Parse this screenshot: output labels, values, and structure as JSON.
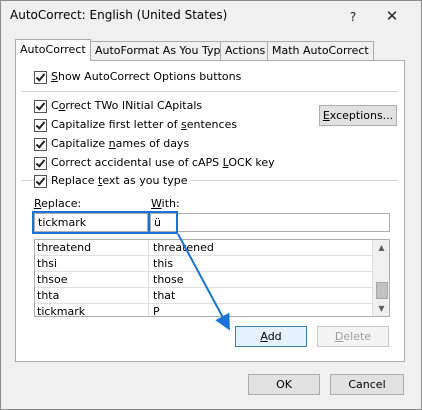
{
  "window": {
    "title": "AutoCorrect: English (United States)",
    "help_glyph": "?",
    "close_glyph": "✕"
  },
  "tabs": [
    {
      "label": "AutoCorrect",
      "active": true
    },
    {
      "label": "AutoFormat As You Type",
      "active": false
    },
    {
      "label": "Actions",
      "active": false
    },
    {
      "label": "Math AutoCorrect",
      "active": false
    }
  ],
  "options": {
    "show_buttons": {
      "pre": "",
      "u": "S",
      "post": "how AutoCorrect Options buttons",
      "checked": true
    },
    "two_initial": {
      "pre": "C",
      "u": "o",
      "post": "rrect TWo INitial CApitals",
      "checked": true
    },
    "first_letter": {
      "pre": "Capitalize first letter of ",
      "u": "s",
      "post": "entences",
      "checked": true
    },
    "days": {
      "pre": "Capitalize ",
      "u": "n",
      "post": "ames of days",
      "checked": true
    },
    "caps_lock": {
      "pre": "Correct accidental use of cAPS ",
      "u": "L",
      "post": "OCK key",
      "checked": true
    },
    "replace_text": {
      "pre": "Replace ",
      "u": "t",
      "post": "ext as you type",
      "checked": true
    }
  },
  "buttons": {
    "exceptions": {
      "u": "E",
      "rest": "xceptions..."
    },
    "add": {
      "u": "A",
      "rest": "dd"
    },
    "delete": {
      "u": "D",
      "rest": "elete"
    },
    "ok": "OK",
    "cancel": "Cancel"
  },
  "replace_label": {
    "u": "R",
    "rest": "eplace:"
  },
  "with_label": {
    "u": "W",
    "rest": "ith:"
  },
  "replace_value": "tickmark",
  "with_value": "ü",
  "entries": [
    {
      "replace": "threatend",
      "with": "threatened"
    },
    {
      "replace": "thsi",
      "with": "this"
    },
    {
      "replace": "thsoe",
      "with": "those"
    },
    {
      "replace": "thta",
      "with": "that"
    },
    {
      "replace": "tickmark",
      "with": "P"
    }
  ],
  "colors": {
    "highlight": "#1a73d6"
  }
}
